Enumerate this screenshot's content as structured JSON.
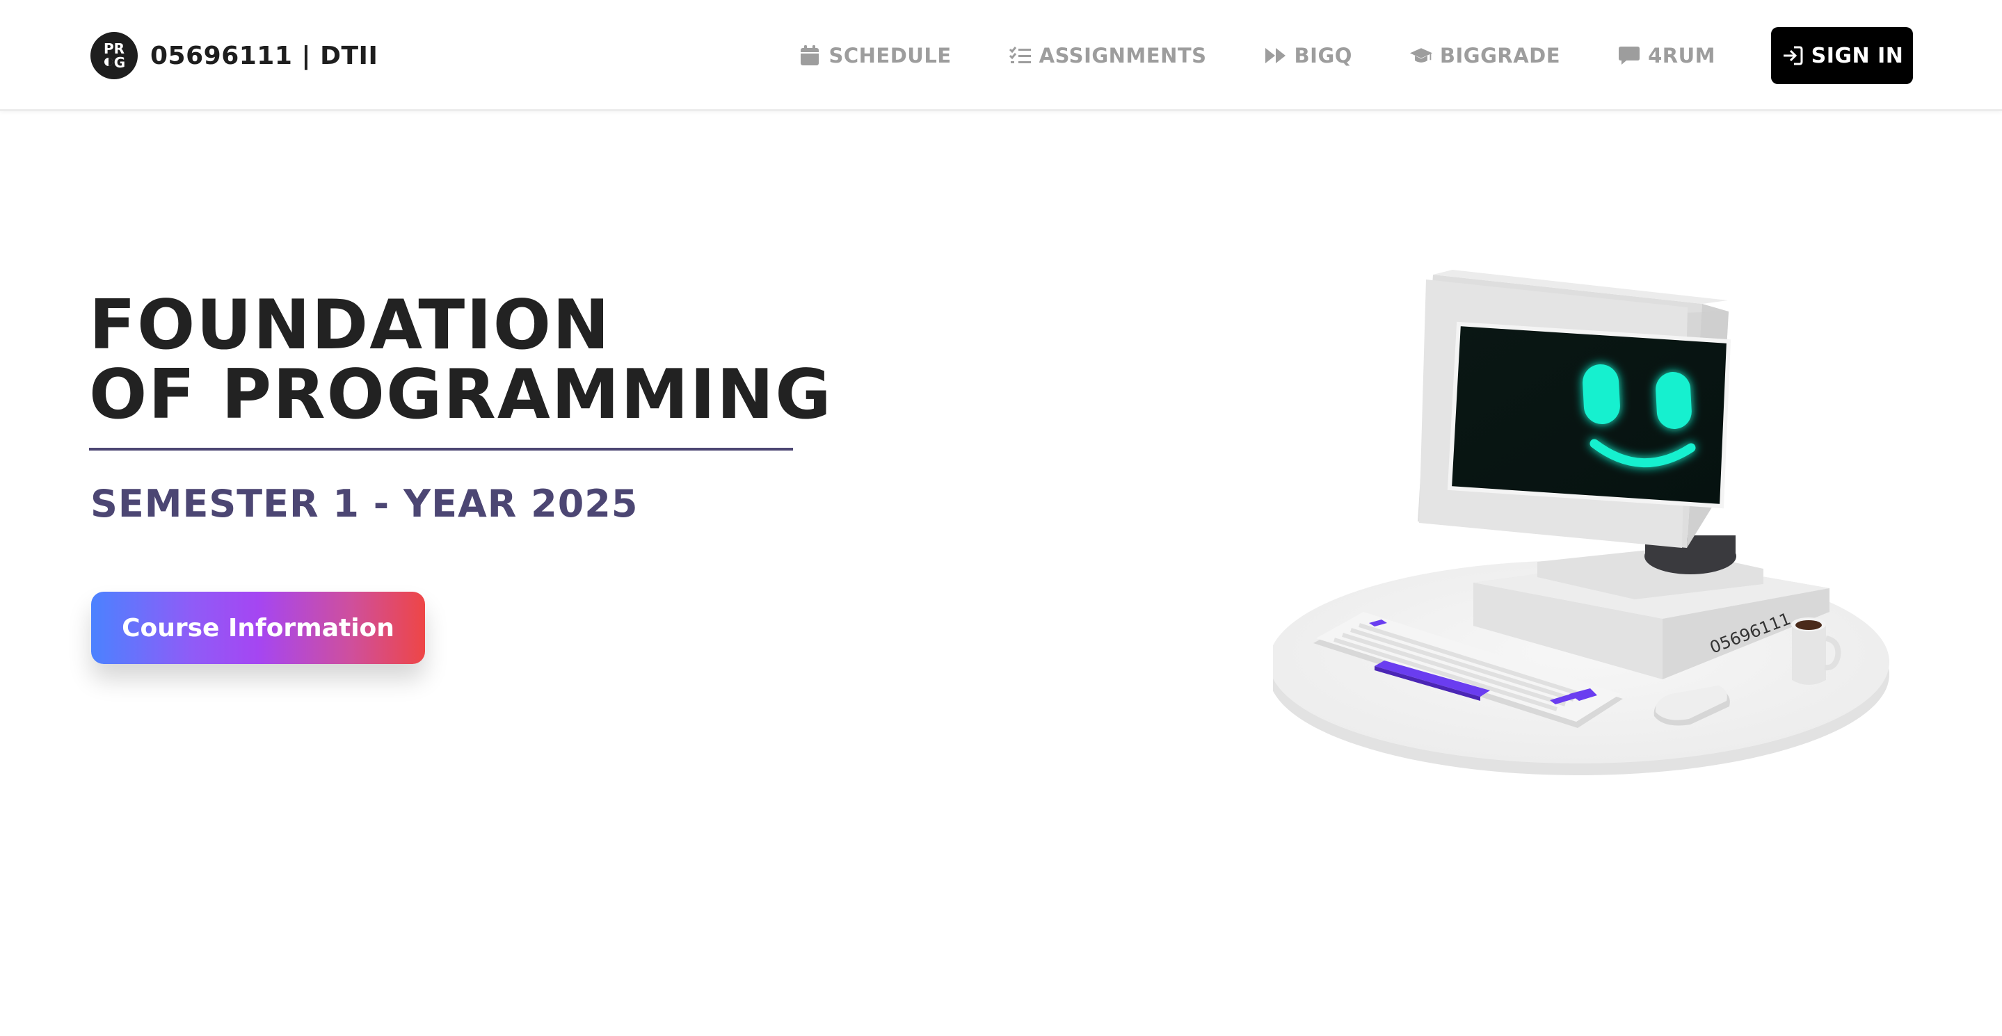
{
  "header": {
    "logo": {
      "top_text": "PR",
      "bottom_text": "G",
      "icon": "prog-logo-icon"
    },
    "title": "05696111 | DTII",
    "nav": [
      {
        "label": "SCHEDULE",
        "icon": "calendar-icon"
      },
      {
        "label": "ASSIGNMENTS",
        "icon": "checklist-icon"
      },
      {
        "label": "BIGQ",
        "icon": "fast-forward-icon"
      },
      {
        "label": "BIGGRADE",
        "icon": "graduation-cap-icon"
      },
      {
        "label": "4RUM",
        "icon": "chat-bubble-icon"
      }
    ],
    "sign_in": {
      "label": "SIGN IN",
      "icon": "sign-in-icon"
    }
  },
  "hero": {
    "title_line1": "FOUNDATION",
    "title_line2": "OF PROGRAMMING",
    "subtitle": "SEMESTER 1 - YEAR 2025",
    "cta_label": "Course Information"
  },
  "illustration": {
    "computer_label": "05696111",
    "icon": "retro-computer-illustration"
  },
  "colors": {
    "nav_text": "#9d9d9d",
    "title_text": "#222222",
    "subtitle": "#4c4673",
    "screen_glow": "#19f0cf",
    "accent_purple": "#6a3df0",
    "cta_gradient": [
      "#4b82ff",
      "#a546f2",
      "#ee4646"
    ]
  }
}
